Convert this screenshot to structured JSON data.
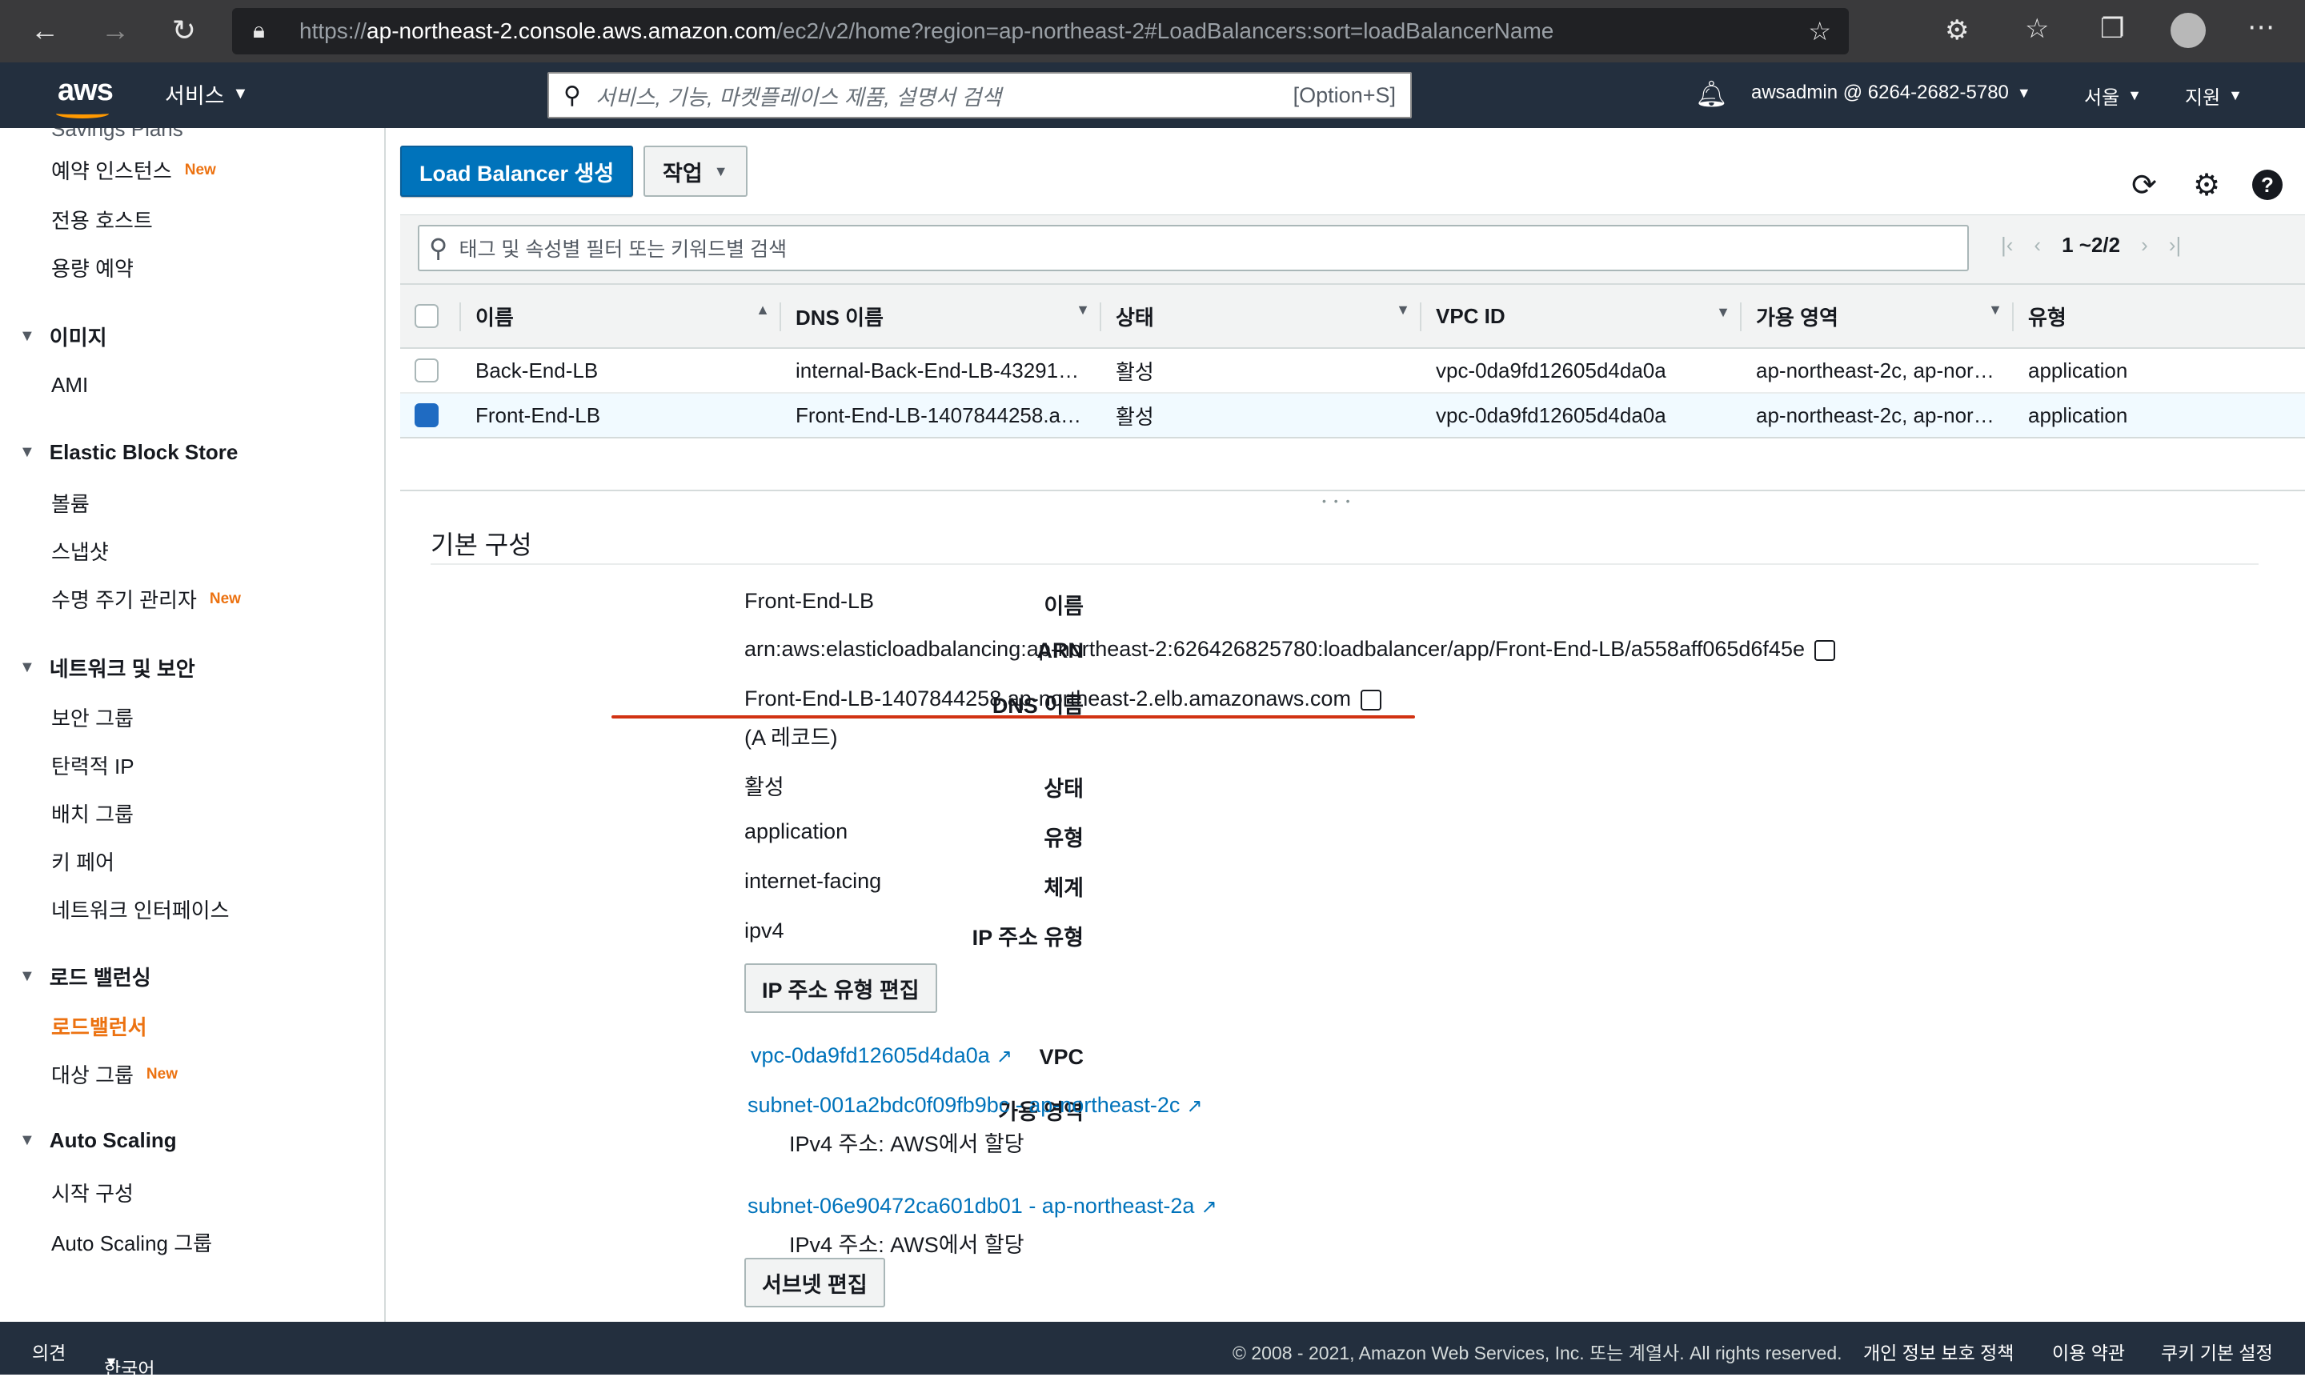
{
  "browser": {
    "url_scheme": "https://",
    "url_host": "ap-northeast-2.console.aws.amazon.com",
    "url_path": "/ec2/v2/home?region=ap-northeast-2#LoadBalancers:sort=loadBalancerName"
  },
  "header": {
    "logo": "aws",
    "services_label": "서비스",
    "search_placeholder": "서비스, 기능, 마켓플레이스 제품, 설명서 검색",
    "search_shortcut": "[Option+S]",
    "account": "awsadmin @ 6264-2682-5780",
    "region": "서울",
    "support": "지원"
  },
  "sidebar": {
    "partial_top": "Savings Plans",
    "new_badge": "New",
    "items": [
      {
        "label": "예약 인스턴스",
        "new": true
      },
      {
        "label": "전용 호스트"
      },
      {
        "label": "용량 예약"
      }
    ],
    "sections": [
      {
        "title": "이미지",
        "items": [
          "AMI"
        ]
      },
      {
        "title": "Elastic Block Store",
        "items": [
          "볼륨",
          "스냅샷",
          "수명 주기 관리자"
        ]
      },
      {
        "title": "네트워크 및 보안",
        "items": [
          "보안 그룹",
          "탄력적 IP",
          "배치 그룹",
          "키 페어",
          "네트워크 인터페이스"
        ]
      },
      {
        "title": "로드 밸런싱",
        "items": [
          "로드밸런서",
          "대상 그룹"
        ]
      },
      {
        "title": "Auto Scaling",
        "items": [
          "시작 구성",
          "Auto Scaling 그룹"
        ]
      }
    ]
  },
  "toolbar": {
    "create_button": "Load Balancer 생성",
    "actions_button": "작업",
    "filter_placeholder": "태그 및 속성별 필터 또는 키워드별 검색",
    "pagination": "1 ~2/2"
  },
  "table": {
    "columns": [
      "이름",
      "DNS 이름",
      "상태",
      "VPC ID",
      "가용 영역",
      "유형"
    ],
    "rows": [
      {
        "name": "Back-End-LB",
        "dns": "internal-Back-End-LB-43291…",
        "state": "활성",
        "vpc": "vpc-0da9fd12605d4da0a",
        "az": "ap-northeast-2c, ap-nor…",
        "type": "application",
        "selected": false
      },
      {
        "name": "Front-End-LB",
        "dns": "Front-End-LB-1407844258.a…",
        "state": "활성",
        "vpc": "vpc-0da9fd12605d4da0a",
        "az": "ap-northeast-2c, ap-nor…",
        "type": "application",
        "selected": true
      }
    ]
  },
  "details": {
    "section_title": "기본 구성",
    "labels": {
      "name": "이름",
      "arn": "ARN",
      "dns": "DNS 이름",
      "state": "상태",
      "type": "유형",
      "scheme": "체계",
      "ip_type": "IP 주소 유형",
      "vpc": "VPC",
      "az": "가용 영역"
    },
    "name": "Front-End-LB",
    "arn": "arn:aws:elasticloadbalancing:ap-northeast-2:626426825780:loadbalancer/app/Front-End-LB/a558aff065d6f45e",
    "dns": "Front-End-LB-1407844258.ap-northeast-2.elb.amazonaws.com",
    "dns_record": "(A 레코드)",
    "state": "활성",
    "type": "application",
    "scheme": "internet-facing",
    "ip_type": "ipv4",
    "edit_ip_button": "IP 주소 유형 편집",
    "vpc": "vpc-0da9fd12605d4da0a",
    "subnets": [
      {
        "link": "subnet-001a2bdc0f09fb9bc - ap-northeast-2c",
        "note": "IPv4 주소: AWS에서 할당"
      },
      {
        "link": "subnet-06e90472ca601db01 - ap-northeast-2a",
        "note": "IPv4 주소: AWS에서 할당"
      }
    ],
    "edit_subnet_button": "서브넷 편집"
  },
  "footer": {
    "feedback": "의견",
    "language": "한국어",
    "copyright": "© 2008 - 2021, Amazon Web Services, Inc. 또는 계열사. All rights reserved.",
    "privacy": "개인 정보 보호 정책",
    "terms": "이용 약관",
    "cookies": "쿠키 기본 설정"
  },
  "colors": {
    "aws_header": "#232f3e",
    "primary_button": "#0073bb",
    "active_nav": "#ec7211",
    "highlight_underline": "#d13212"
  }
}
